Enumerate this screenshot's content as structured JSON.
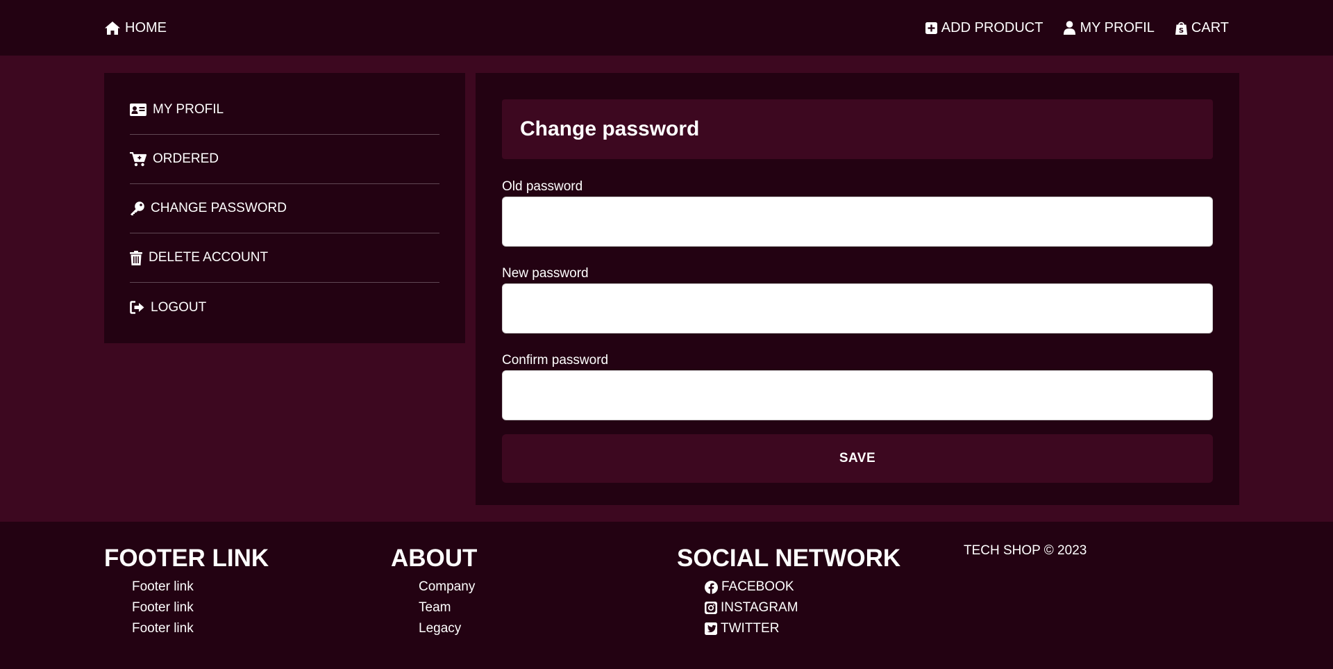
{
  "colors": {
    "page_bg": "#3d0820",
    "panel_bg": "#230212",
    "accent_bg": "#3d0820",
    "text": "#ffffff",
    "input_bg": "#ffffff"
  },
  "nav": {
    "home": {
      "label": "HOME",
      "icon": "home-icon"
    },
    "add_product": {
      "label": "ADD PRODUCT",
      "icon": "plus-square-icon"
    },
    "my_profil": {
      "label": "MY PROFIL",
      "icon": "user-icon"
    },
    "cart": {
      "label": "CART",
      "icon": "shopping-bag-icon"
    }
  },
  "sidebar": {
    "items": [
      {
        "label": "MY PROFIL",
        "icon": "id-card-icon"
      },
      {
        "label": "ORDERED",
        "icon": "cart-icon"
      },
      {
        "label": "CHANGE PASSWORD",
        "icon": "key-icon"
      },
      {
        "label": "DELETE ACCOUNT",
        "icon": "trash-icon"
      },
      {
        "label": "LOGOUT",
        "icon": "logout-icon"
      }
    ]
  },
  "form": {
    "title": "Change password",
    "old_password": {
      "label": "Old password",
      "value": "",
      "placeholder": ""
    },
    "new_password": {
      "label": "New password",
      "value": "",
      "placeholder": ""
    },
    "confirm_password": {
      "label": "Confirm password",
      "value": "",
      "placeholder": ""
    },
    "save_label": "SAVE"
  },
  "footer": {
    "links": {
      "heading": "FOOTER LINK",
      "items": [
        "Footer link",
        "Footer link",
        "Footer link"
      ]
    },
    "about": {
      "heading": "ABOUT",
      "items": [
        "Company",
        "Team",
        "Legacy"
      ]
    },
    "social": {
      "heading": "SOCIAL NETWORK",
      "items": [
        {
          "label": "FACEBOOK",
          "icon": "facebook-icon"
        },
        {
          "label": "INSTAGRAM",
          "icon": "instagram-icon"
        },
        {
          "label": "TWITTER",
          "icon": "twitter-icon"
        }
      ]
    },
    "copyright": "TECH SHOP © 2023"
  }
}
